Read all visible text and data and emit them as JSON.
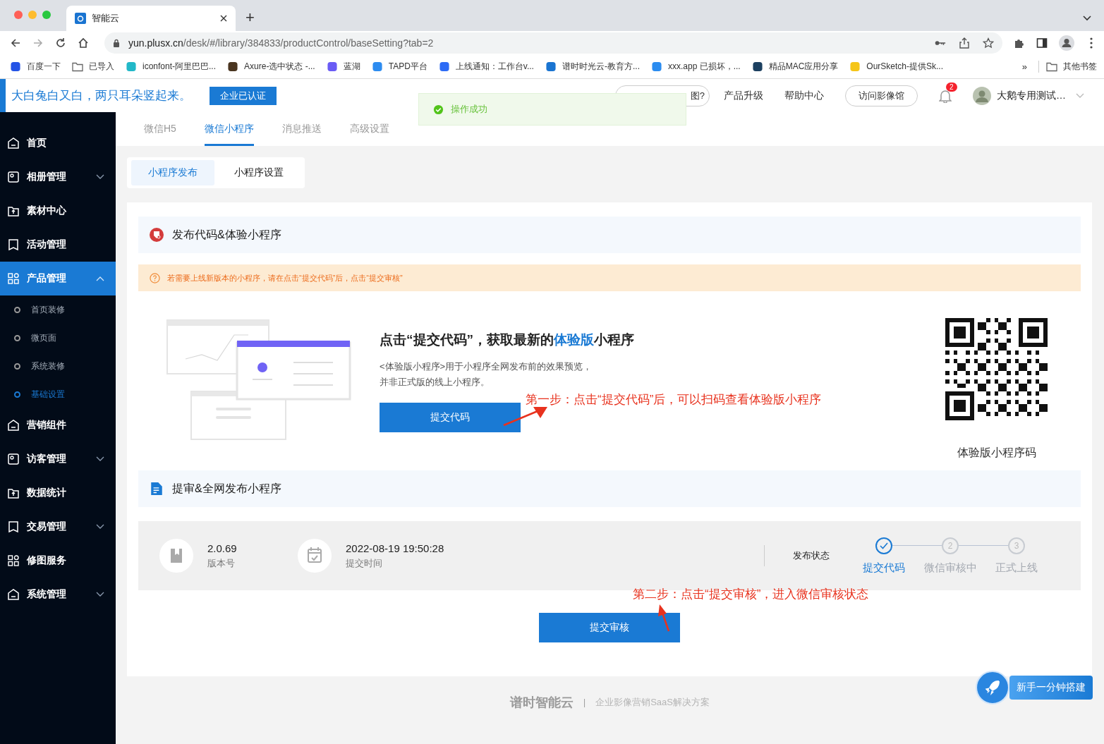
{
  "browser": {
    "tab_title": "智能云",
    "new_tab": "+",
    "url_host": "yun.plusx.cn",
    "url_path": "/desk/#/library/384833/productControl/baseSetting?tab=2",
    "bookmarks": [
      {
        "label": "百度一下",
        "kind": "site"
      },
      {
        "label": "已导入",
        "kind": "folder"
      },
      {
        "label": "iconfont-阿里巴巴...",
        "kind": "site"
      },
      {
        "label": "Axure-选中状态 -...",
        "kind": "site"
      },
      {
        "label": "蓝湖",
        "kind": "site"
      },
      {
        "label": "TAPD平台",
        "kind": "site"
      },
      {
        "label": "上线通知：工作台v...",
        "kind": "site"
      },
      {
        "label": "谱时时光云-教育方...",
        "kind": "site"
      },
      {
        "label": "xxx.app 已损坏，...",
        "kind": "site"
      },
      {
        "label": "精品MAC应用分享",
        "kind": "site"
      },
      {
        "label": "OurSketch-提供Sk...",
        "kind": "site"
      }
    ],
    "more": "»",
    "other_bookmarks": "其他书签"
  },
  "header": {
    "brand": "大白兔白又白，两只耳朵竖起来。",
    "verified": "企业已认证",
    "hint_pill": "图?",
    "links": [
      "产品升级",
      "帮助中心"
    ],
    "gallery": "访问影像馆",
    "notifications": "2",
    "user": "大鹅专用测试…"
  },
  "toast": {
    "message": "操作成功"
  },
  "sidebar": [
    {
      "label": "首页",
      "selected": false
    },
    {
      "label": "相册管理",
      "selected": false,
      "expanded": false
    },
    {
      "label": "素材中心",
      "selected": false
    },
    {
      "label": "活动管理",
      "selected": false
    },
    {
      "label": "产品管理",
      "selected": true,
      "expanded": true,
      "children": [
        {
          "label": "首页装修",
          "selected": false
        },
        {
          "label": "微页面",
          "selected": false
        },
        {
          "label": "系统装修",
          "selected": false
        },
        {
          "label": "基础设置",
          "selected": true
        }
      ]
    },
    {
      "label": "营销组件",
      "selected": false
    },
    {
      "label": "访客管理",
      "selected": false,
      "expanded": false
    },
    {
      "label": "数据统计",
      "selected": false
    },
    {
      "label": "交易管理",
      "selected": false,
      "expanded": false
    },
    {
      "label": "修图服务",
      "selected": false
    },
    {
      "label": "系统管理",
      "selected": false,
      "expanded": false
    }
  ],
  "tabs": [
    {
      "label": "微信H5",
      "selected": false
    },
    {
      "label": "微信小程序",
      "selected": true
    },
    {
      "label": "消息推送",
      "selected": false
    },
    {
      "label": "高级设置",
      "selected": false
    }
  ],
  "subtabs": [
    {
      "label": "小程序发布",
      "selected": true
    },
    {
      "label": "小程序设置",
      "selected": false
    }
  ],
  "release": {
    "title": "发布代码&体验小程序",
    "notice": "若需要上线新版本的小程序，请在点击“提交代码”后，点击“提交审核”",
    "heading": [
      {
        "text": "点击“提交代码”，获取最新的",
        "highlight": false
      },
      {
        "text": "体验版",
        "highlight": true
      },
      {
        "text": "小程序",
        "highlight": false
      }
    ],
    "description": [
      "<体验版小程序>用于小程序全网发布前的效果预览，",
      "并非正式版的线上小程序。"
    ],
    "button": "提交代码",
    "qr_caption": "体验版小程序码",
    "annotation": "第一步：点击“提交代码”后，可以扫码查看体验版小程序"
  },
  "publish": {
    "title": "提审&全网发布小程序",
    "version": "2.0.69",
    "version_label": "版本号",
    "time": "2022-08-19 19:50:28",
    "time_label": "提交时间",
    "status_label": "发布状态",
    "steps": [
      {
        "label": "提交代码",
        "done": true
      },
      {
        "label": "微信审核中",
        "done": false,
        "number": "2"
      },
      {
        "label": "正式上线",
        "done": false,
        "number": "3"
      }
    ],
    "annotation": "第二步：点击“提交审核”，进入微信审核状态",
    "button": "提交审核"
  },
  "footer": {
    "logo": "谱时智能云",
    "separator": "|",
    "tagline": "企业影像营销SaaS解决方案"
  },
  "float_button": "新手一分钟搭建"
}
